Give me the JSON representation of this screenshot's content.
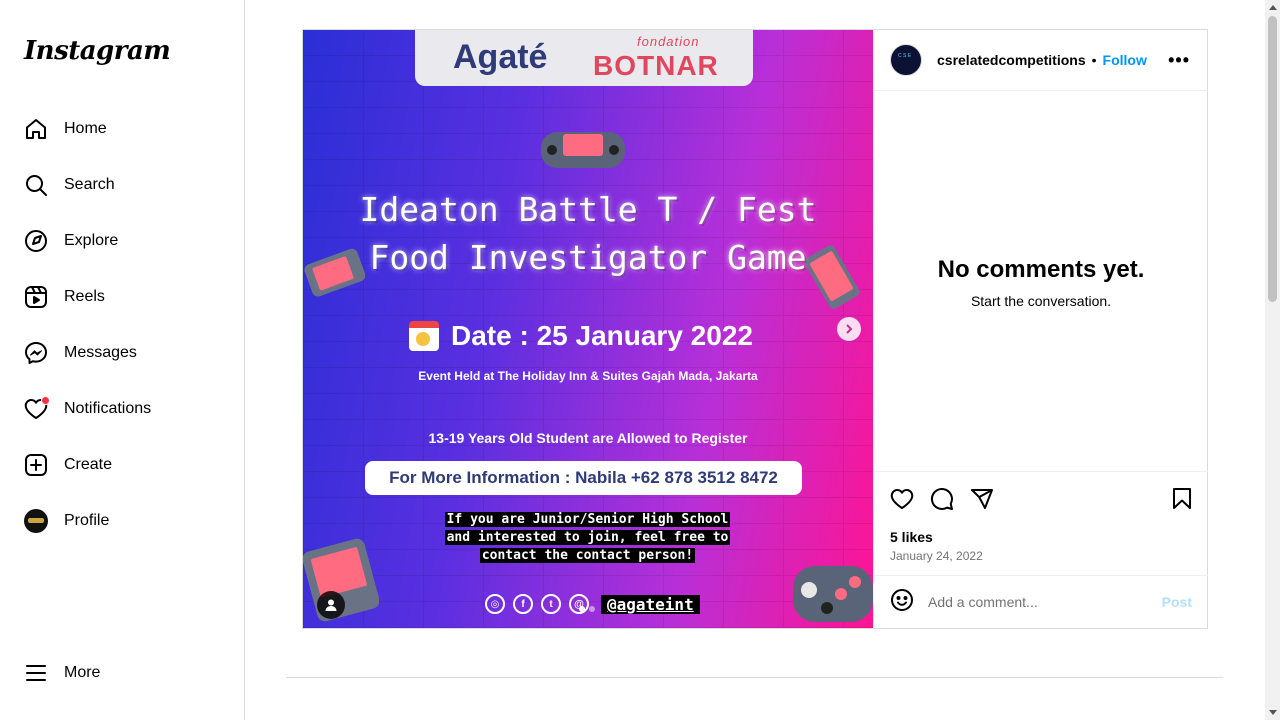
{
  "app": {
    "logo_text": "Instagram"
  },
  "sidebar": {
    "items": [
      {
        "label": "Home",
        "icon": "home-icon"
      },
      {
        "label": "Search",
        "icon": "search-icon"
      },
      {
        "label": "Explore",
        "icon": "compass-icon"
      },
      {
        "label": "Reels",
        "icon": "reels-icon"
      },
      {
        "label": "Messages",
        "icon": "messenger-icon"
      },
      {
        "label": "Notifications",
        "icon": "heart-icon"
      },
      {
        "label": "Create",
        "icon": "plus-square-icon"
      },
      {
        "label": "Profile",
        "icon": "avatar"
      }
    ],
    "more_label": "More"
  },
  "post": {
    "username": "csrelatedcompetitions",
    "separator": "•",
    "follow_label": "Follow",
    "more_label": "•••",
    "empty_title": "No comments yet.",
    "empty_subtitle": "Start the conversation.",
    "likes": "5 likes",
    "date": "January 24, 2022",
    "comment_placeholder": "Add a comment...",
    "post_label": "Post",
    "carousel": {
      "current_index": 1,
      "total": 2
    }
  },
  "flyer": {
    "brand_left": "Agaté",
    "brand_small": "fondation",
    "brand_right": "BOTNAR",
    "title_line1": "Ideaton Battle T / Fest",
    "title_line2": "Food Investigator Game",
    "date_text": "Date : 25 January 2022",
    "venue": "Event Held at The Holiday Inn & Suites Gajah Mada, Jakarta",
    "eligibility": "13-19 Years Old Student are Allowed to Register",
    "contact": "For More Information : Nabila +62 878 3512 8472",
    "note_line1": "If you are Junior/Senior High School",
    "note_line2": "and interested to join, feel free to",
    "note_line3": "contact the contact person!",
    "handle": "@agateint"
  },
  "colors": {
    "accent": "#0095f6",
    "notification_dot": "#ff3040",
    "post_disabled": "#b2dffc",
    "flyer_gradient_start": "#2a2fd6",
    "flyer_gradient_end": "#ff1493"
  }
}
